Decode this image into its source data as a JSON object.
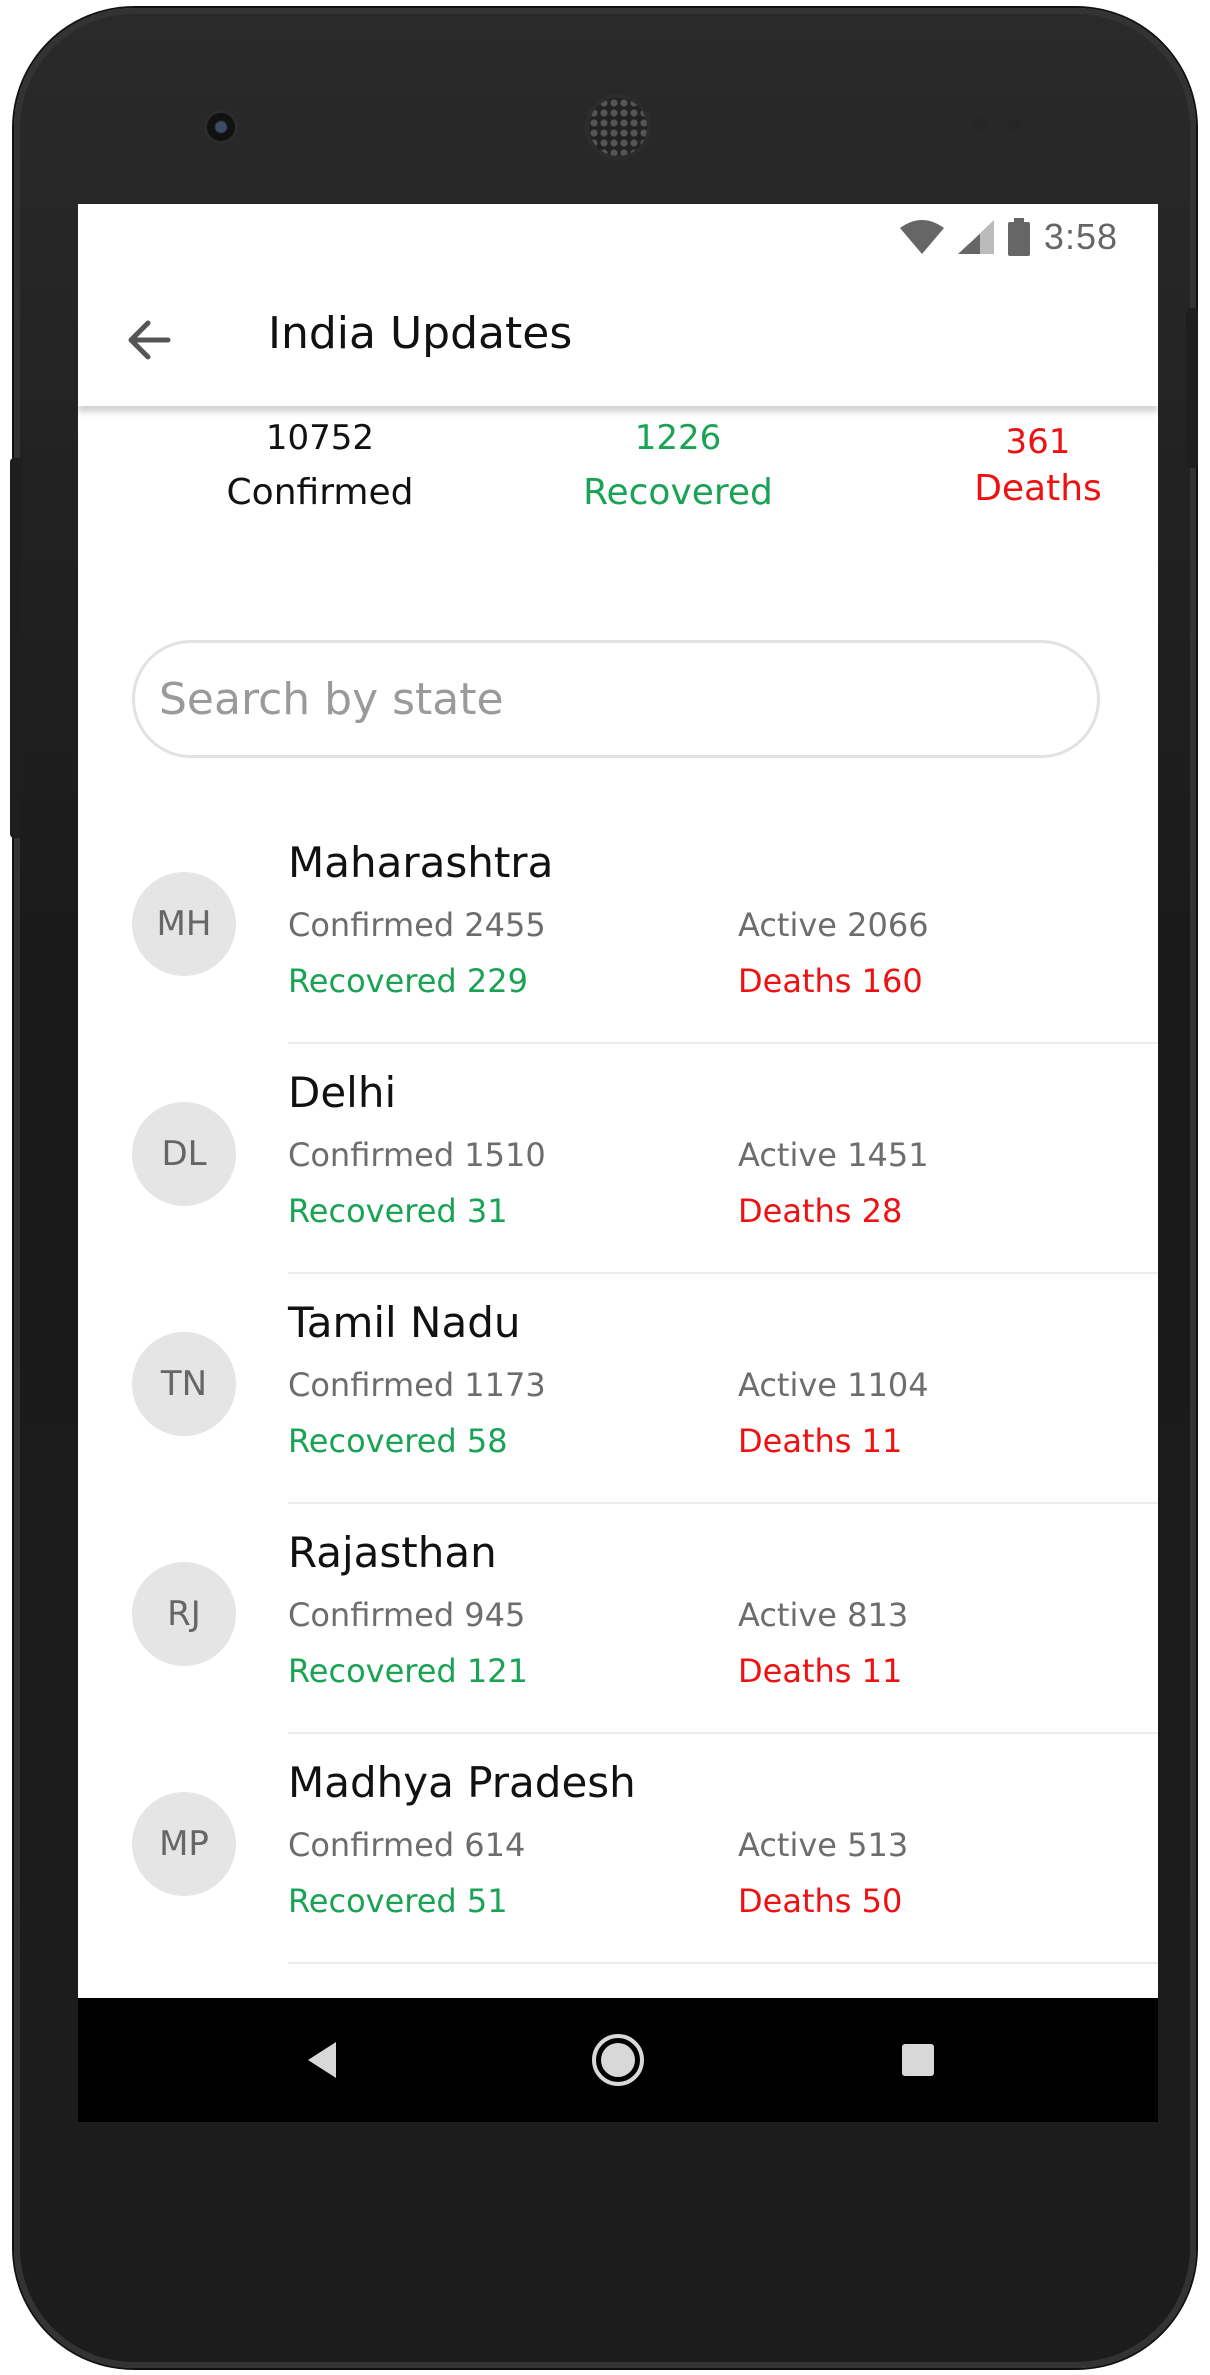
{
  "status_bar": {
    "time": "3:58"
  },
  "app_bar": {
    "title": "India Updates"
  },
  "summary": {
    "confirmed": {
      "value": "10752",
      "label": "Confirmed"
    },
    "recovered": {
      "value": "1226",
      "label": "Recovered"
    },
    "deaths": {
      "value": "361",
      "label": "Deaths"
    }
  },
  "search": {
    "placeholder": "Search by state",
    "value": ""
  },
  "states": [
    {
      "code": "MH",
      "name": "Maharashtra",
      "confirmed_label": "Confirmed",
      "confirmed": "2455",
      "active_label": "Active",
      "active": "2066",
      "recovered_label": "Recovered",
      "recovered": "229",
      "deaths_label": "Deaths",
      "deaths": "160"
    },
    {
      "code": "DL",
      "name": "Delhi",
      "confirmed_label": "Confirmed",
      "confirmed": "1510",
      "active_label": "Active",
      "active": "1451",
      "recovered_label": "Recovered",
      "recovered": "31",
      "deaths_label": "Deaths",
      "deaths": "28"
    },
    {
      "code": "TN",
      "name": "Tamil Nadu",
      "confirmed_label": "Confirmed",
      "confirmed": "1173",
      "active_label": "Active",
      "active": "1104",
      "recovered_label": "Recovered",
      "recovered": "58",
      "deaths_label": "Deaths",
      "deaths": "11"
    },
    {
      "code": "RJ",
      "name": "Rajasthan",
      "confirmed_label": "Confirmed",
      "confirmed": "945",
      "active_label": "Active",
      "active": "813",
      "recovered_label": "Recovered",
      "recovered": "121",
      "deaths_label": "Deaths",
      "deaths": "11"
    },
    {
      "code": "MP",
      "name": "Madhya Pradesh",
      "confirmed_label": "Confirmed",
      "confirmed": "614",
      "active_label": "Active",
      "active": "513",
      "recovered_label": "Recovered",
      "recovered": "51",
      "deaths_label": "Deaths",
      "deaths": "50"
    }
  ],
  "colors": {
    "recovered": "#1aa354",
    "deaths": "#ee1111",
    "muted": "#6d6d6d",
    "avatar_bg": "#e5e5e5"
  },
  "icons": {
    "back": "arrow-left-icon",
    "wifi": "wifi-icon",
    "signal": "signal-icon",
    "battery": "battery-icon",
    "nav_back": "triangle-back-icon",
    "nav_home": "circle-home-icon",
    "nav_recents": "square-recents-icon"
  }
}
